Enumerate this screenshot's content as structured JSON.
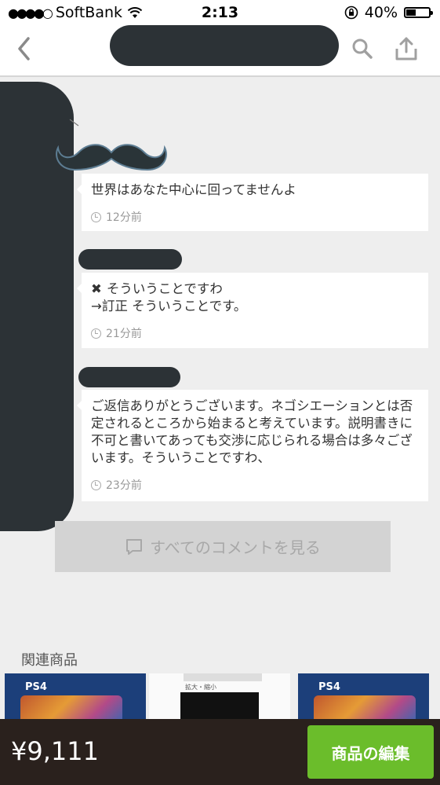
{
  "status_bar": {
    "carrier": "SoftBank",
    "time": "2:13",
    "battery": "40%",
    "battery_level": 0.4
  },
  "comments": [
    {
      "text": "世界はあなた中心に回ってませんよ",
      "time": "12分前"
    },
    {
      "text_line1": "そういうことですわ",
      "text_line2": "→訂正 そういうことです。",
      "time": "21分前"
    },
    {
      "text": "ご返信ありがとうございます。ネゴシエーションとは否定されるところから始まると考えています。説明書きに不可と書いてあっても交渉に応じられる場合は多々ございます。そういうことですわ、",
      "time": "23分前"
    }
  ],
  "all_comments_button": "すべてのコメントを見る",
  "related": {
    "title": "関連商品",
    "items": [
      {
        "badge": "PS4"
      },
      {
        "label": "拡大・縮小"
      },
      {
        "badge": "PS4"
      }
    ]
  },
  "bottom": {
    "price": "¥9,111",
    "edit_button": "商品の編集"
  },
  "colors": {
    "accent_green": "#6bbd2b",
    "bottom_bar": "#2a211d",
    "redaction": "#2c3236"
  }
}
